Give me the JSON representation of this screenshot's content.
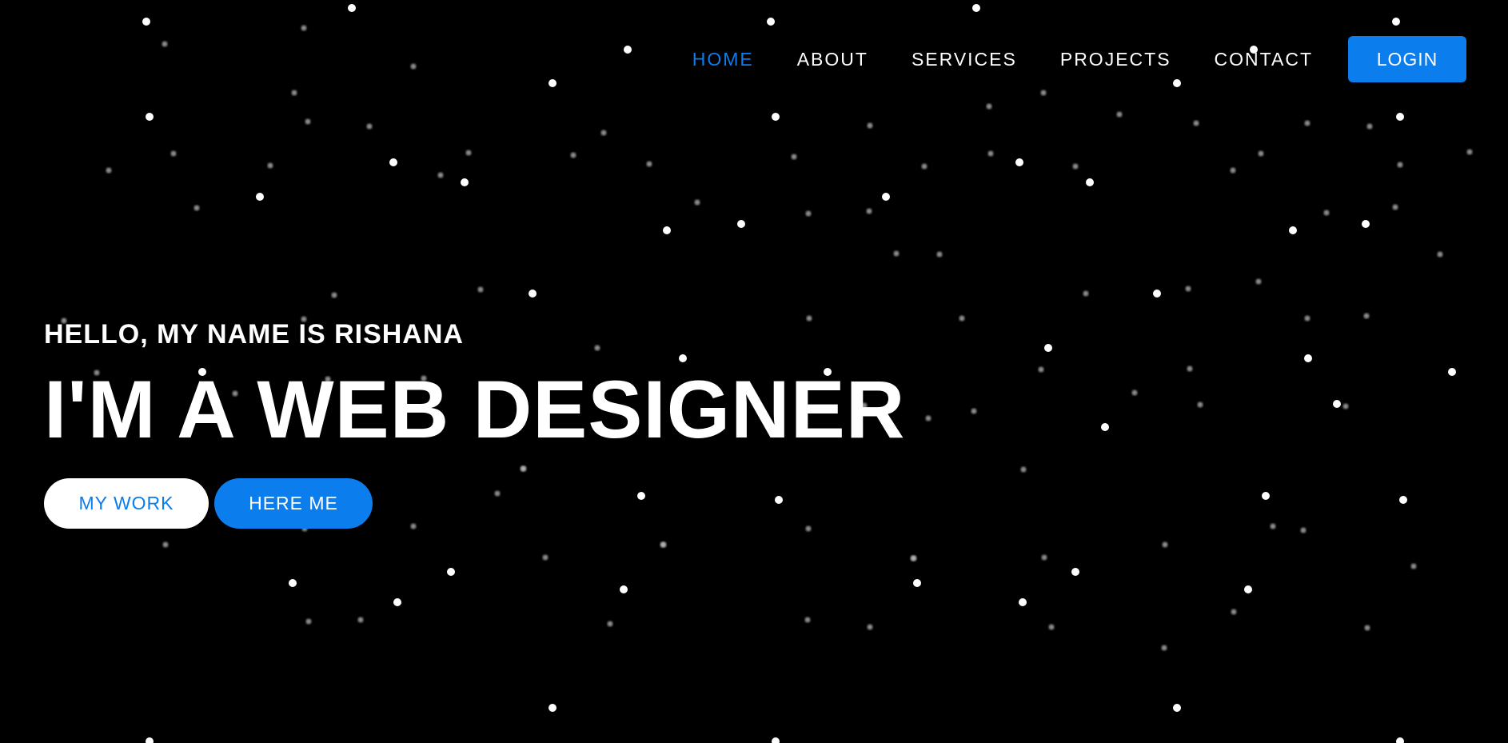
{
  "nav": {
    "items": [
      {
        "label": "HOME",
        "active": true
      },
      {
        "label": "ABOUT",
        "active": false
      },
      {
        "label": "SERVICES",
        "active": false
      },
      {
        "label": "PROJECTS",
        "active": false
      },
      {
        "label": "CONTACT",
        "active": false
      }
    ],
    "login_label": "LOGIN"
  },
  "hero": {
    "intro": "HELLO, MY NAME IS RISHANA",
    "title": "I'M A WEB DESIGNER",
    "primary_button": "MY WORK",
    "secondary_button": "HERE ME"
  },
  "colors": {
    "accent": "#0b7dec",
    "background": "#000000",
    "text": "#ffffff"
  }
}
